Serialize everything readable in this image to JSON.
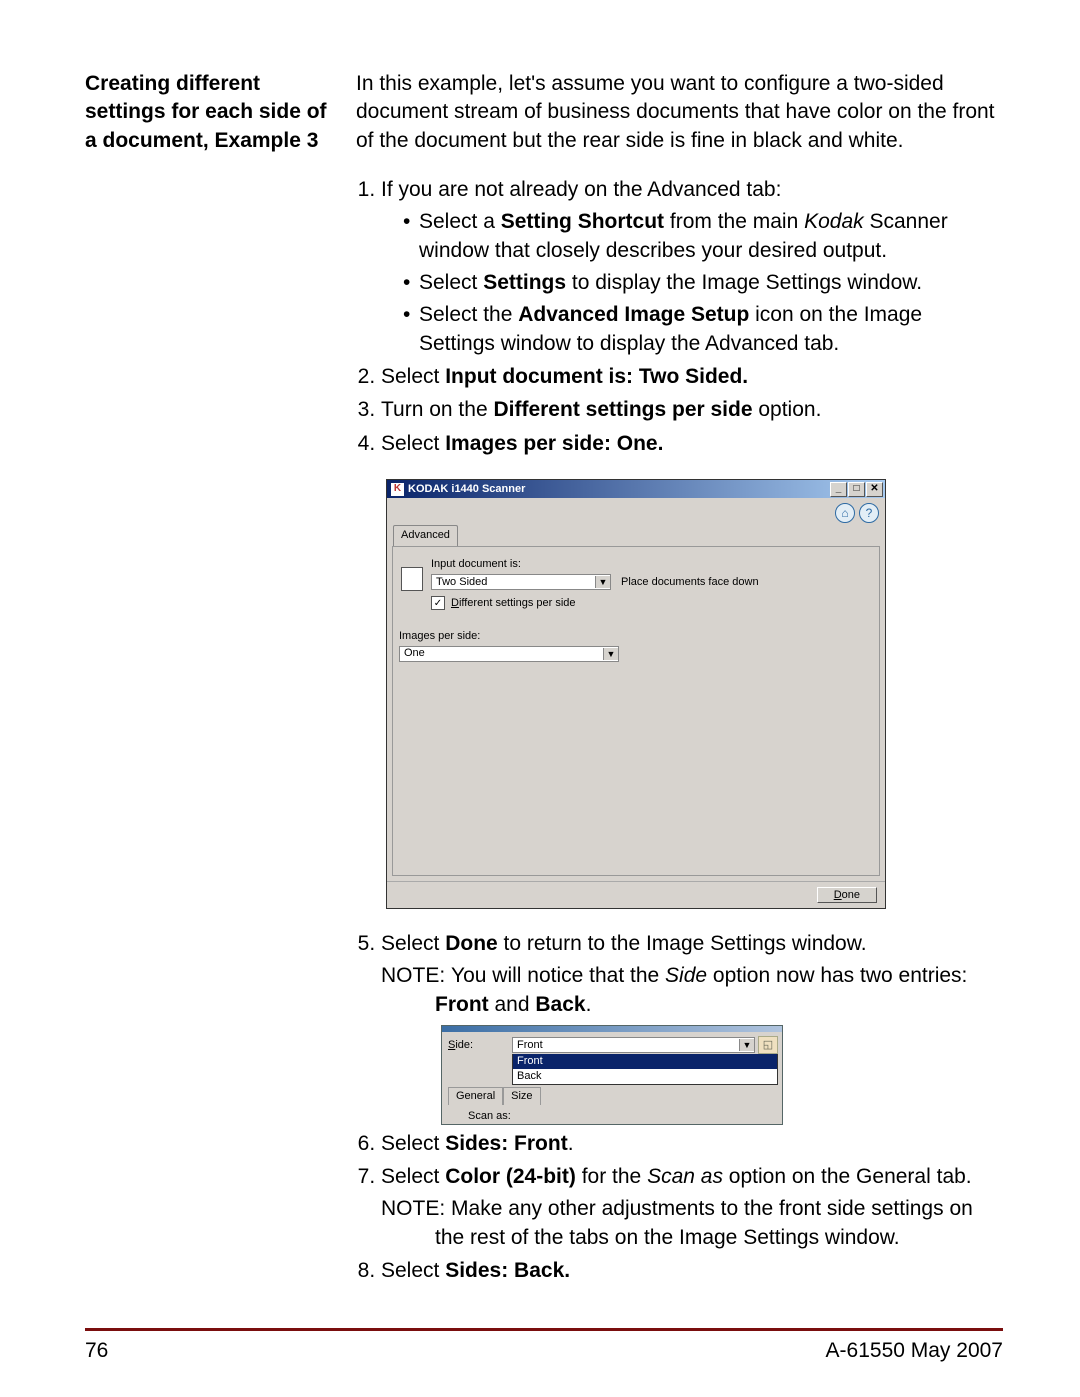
{
  "heading": "Creating different settings for each side of a document, Example 3",
  "intro": "In this example, let's assume you want to configure a two-sided document stream of business documents that have color on the front of the document but the rear side is fine in black and white.",
  "step1_lead": "If you are not already on the Advanced tab:",
  "step1_b1_pre": "Select a ",
  "step1_b1_bold": "Setting Shortcut",
  "step1_b1_mid": " from the main ",
  "step1_b1_italic": "Kodak",
  "step1_b1_post": " Scanner window that closely describes your desired output.",
  "step1_b2_pre": "Select ",
  "step1_b2_bold": "Settings",
  "step1_b2_post": " to display the Image Settings window.",
  "step1_b3_pre": "Select the ",
  "step1_b3_bold": "Advanced Image Setup",
  "step1_b3_post": " icon on the Image Settings window to display the Advanced tab.",
  "step2_pre": "Select ",
  "step2_bold": "Input document is: Two Sided.",
  "step3_pre": "Turn on the ",
  "step3_bold": "Different settings per side",
  "step3_post": " option.",
  "step4_pre": "Select ",
  "step4_bold": "Images per side: One.",
  "win1": {
    "title": "KODAK i1440 Scanner",
    "tab": "Advanced",
    "input_doc_label": "Input document is:",
    "input_doc_value": "Two Sided",
    "place_note": "Place documents face down",
    "diff_checkbox_label": "Different settings per side",
    "diff_checkbox_underline": "D",
    "images_label": "Images per side:",
    "images_value": "One",
    "done_label": "one",
    "done_underline": "D"
  },
  "step5_pre": "Select ",
  "step5_bold": "Done",
  "step5_post": " to return to the Image Settings window.",
  "note1_label": "NOTE:",
  "note1_pre": "You will notice that the ",
  "note1_italic": "Side",
  "note1_mid": " option now has two entries: ",
  "note1_bold1": "Front",
  "note1_and": " and ",
  "note1_bold2": "Back",
  "note1_dot": ".",
  "win2": {
    "side_label": "Side:",
    "side_underline": "S",
    "side_value": "Front",
    "drop_front": "Front",
    "drop_back": "Back",
    "tab_general": "General",
    "tab_size": "Size",
    "scan_as": "Scan as:"
  },
  "step6_pre": "Select ",
  "step6_bold": "Sides: Front",
  "step6_dot": ".",
  "step7_pre": "Select ",
  "step7_bold": "Color (24-bit)",
  "step7_mid": " for the ",
  "step7_italic": "Scan as",
  "step7_post": " option on the General tab.",
  "note2_label": "NOTE:",
  "note2_text": "Make any other adjustments to the front side settings on the rest of the tabs on the Image Settings window.",
  "step8_pre": "Select ",
  "step8_bold": "Sides: Back.",
  "footer_left": "76",
  "footer_right": "A-61550  May 2007"
}
